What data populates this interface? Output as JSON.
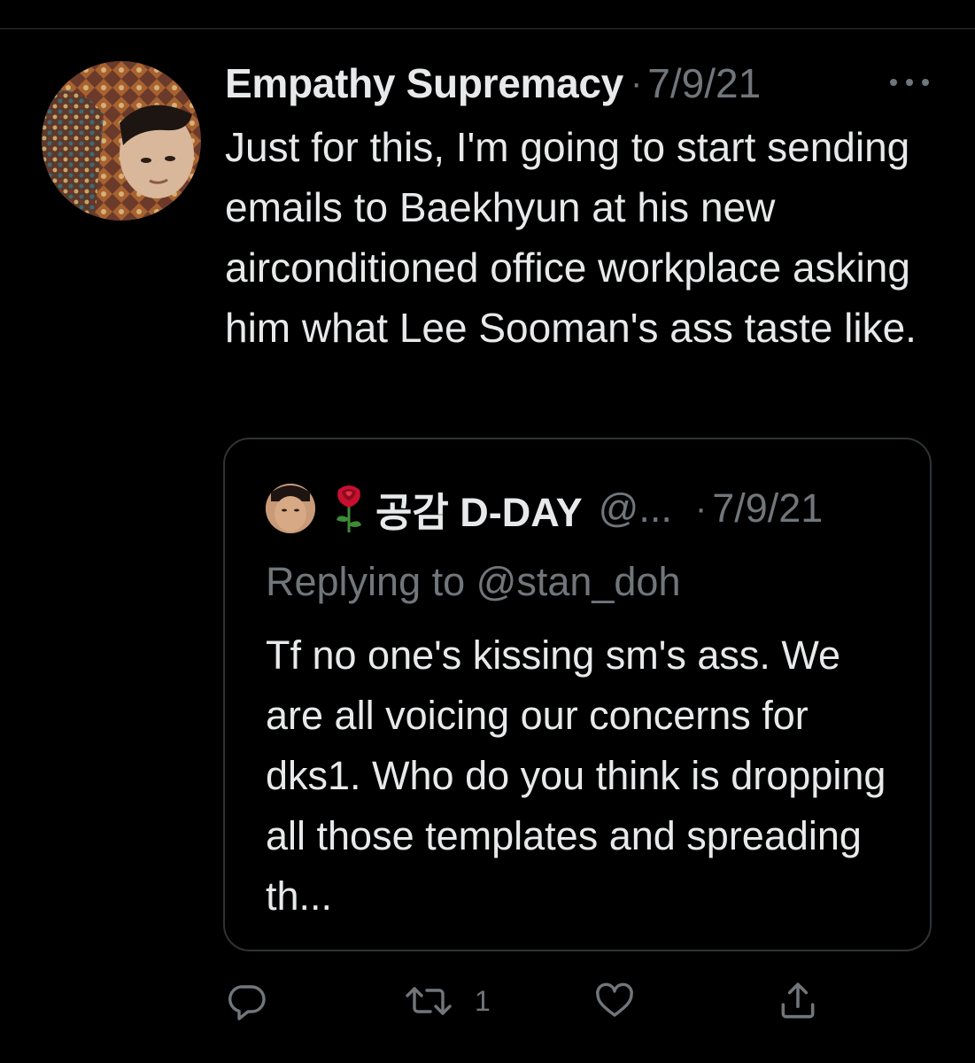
{
  "tweet": {
    "author_name": "Empathy Supremacy",
    "separator": "·",
    "date": "7/9/21",
    "text": "Just for this, I'm going to start sending emails to Baekhyun at his new airconditioned office workplace asking him what Lee Sooman's ass taste like."
  },
  "quoted_tweet": {
    "author_name": "공감 D-DAY",
    "author_emoji_icon": "rose-icon",
    "handle": "@...",
    "separator": "·",
    "date": "7/9/21",
    "replying_to": "Replying to @stan_doh",
    "text": "Tf no one's kissing sm's ass. We are all voicing our concerns for dks1. Who do you think is dropping all those templates and spreading th..."
  },
  "actions": {
    "reply_icon": "reply-icon",
    "retweet_icon": "retweet-icon",
    "retweet_count": "1",
    "like_icon": "heart-icon",
    "share_icon": "share-icon"
  },
  "colors": {
    "background": "#000000",
    "text_primary": "#e7e9ea",
    "text_secondary": "#71767b",
    "border": "#2f3336",
    "rose": "#c8102e"
  }
}
